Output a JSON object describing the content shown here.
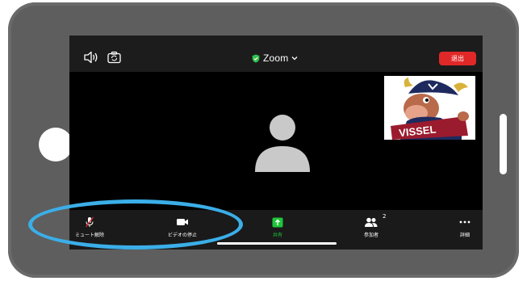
{
  "topbar": {
    "title": "Zoom",
    "leave_label": "退出"
  },
  "toolbar": {
    "items": [
      {
        "label": "ミュート解除"
      },
      {
        "label": "ビデオの停止"
      },
      {
        "label": "共有"
      },
      {
        "label": "参加者",
        "badge": "2"
      },
      {
        "label": "詳細"
      }
    ]
  },
  "thumbnail": {
    "banner_text": "VISSEL"
  },
  "colors": {
    "leave_red": "#e02828",
    "share_green": "#1ec63a",
    "shield_green": "#2fc24b",
    "highlight_blue": "#3baee8"
  }
}
